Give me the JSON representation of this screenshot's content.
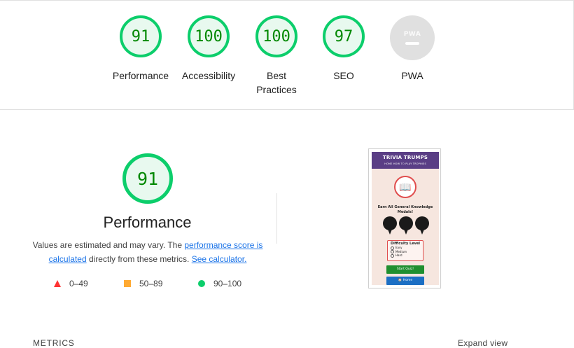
{
  "summary": {
    "gauges": [
      {
        "score": "91",
        "label": "Performance"
      },
      {
        "score": "100",
        "label": "Accessibility"
      },
      {
        "score": "100",
        "label": "Best Practices"
      },
      {
        "score": "97",
        "label": "SEO"
      },
      {
        "score": "",
        "label": "PWA",
        "badge_text": "PWA"
      }
    ]
  },
  "performance": {
    "score": "91",
    "title": "Performance",
    "desc_prefix": "Values are estimated and may vary. The ",
    "link_score": "performance score is calculated",
    "desc_middle": " directly from these metrics. ",
    "link_calc": "See calculator.",
    "legend": [
      {
        "range": "0–49",
        "color": "#ff3333"
      },
      {
        "range": "50–89",
        "color": "#ffaa33"
      },
      {
        "range": "90–100",
        "color": "#0cce6b"
      }
    ]
  },
  "screenshot": {
    "app_title": "TRIVIA TRUMPS",
    "nav": "HOME   HOW TO PLAY   TROPHIES",
    "earn_text": "Earn All General Knowledge Medals!",
    "difficulty_title": "Difficulty Level",
    "options": [
      "Easy",
      "Medium",
      "Hard"
    ],
    "start_button": "Start Quiz!",
    "home_button": "🏠 Home",
    "logo_icon": "📖"
  },
  "footer": {
    "metrics_label": "METRICS",
    "expand_label": "Expand view"
  },
  "colors": {
    "pass": "#0cce6b",
    "pass_text": "#008800",
    "link": "#1a73e8",
    "app_header": "#5a3e85"
  }
}
